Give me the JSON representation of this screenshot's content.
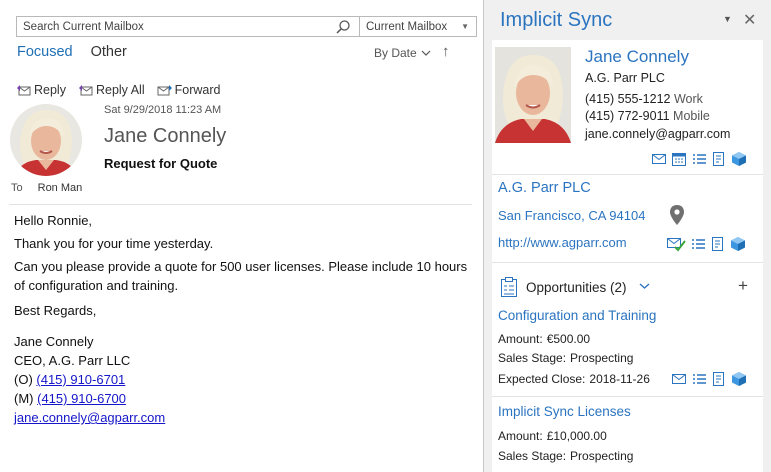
{
  "mail": {
    "search_placeholder": "Search Current Mailbox",
    "scope": "Current Mailbox",
    "tabs": {
      "focused": "Focused",
      "other": "Other"
    },
    "sort_label": "By Date",
    "actions": {
      "reply": "Reply",
      "reply_all": "Reply All",
      "forward": "Forward"
    },
    "date": "Sat 9/29/2018 11:23 AM",
    "sender": "Jane Connely",
    "subject": "Request for Quote",
    "to_label": "To",
    "to_name": "Ron Man",
    "body": {
      "greeting": "Hello Ronnie,",
      "line1": "Thank you for your time yesterday.",
      "line2": "Can you please provide a quote for 500 user licenses. Please include 10 hours of configuration and training.",
      "closing": "Best Regards,",
      "sig_name": "Jane Connely",
      "sig_title": "CEO, A.G. Parr LLC",
      "sig_office_prefix": "(O) ",
      "sig_office": "(415) 910-6701",
      "sig_mobile_prefix": "(M) ",
      "sig_mobile": "(415) 910-6700",
      "sig_email": "jane.connely@agparr.com"
    }
  },
  "panel": {
    "title": "Implicit Sync",
    "contact": {
      "name": "Jane Connely",
      "company": "A.G. Parr PLC",
      "phone_work": "(415) 555-1212",
      "phone_work_label": "Work",
      "phone_mobile": "(415) 772-9011",
      "phone_mobile_label": "Mobile",
      "email": "jane.connely@agparr.com"
    },
    "account": {
      "name": "A.G. Parr PLC",
      "city": "San Francisco, CA 94104",
      "website": "http://www.agparr.com"
    },
    "opportunities": {
      "header": "Opportunities (2)",
      "items": [
        {
          "title": "Configuration and Training",
          "amount_label": "Amount:",
          "amount": "€500.00",
          "stage_label": "Sales Stage:",
          "stage": "Prospecting",
          "close_label": "Expected Close:",
          "close": "2018-11-26"
        },
        {
          "title": "Implicit Sync Licenses",
          "amount_label": "Amount:",
          "amount": "£10,000.00",
          "stage_label": "Sales Stage:",
          "stage": "Prospecting"
        }
      ]
    }
  },
  "colors": {
    "accent": "#2b74c0",
    "link": "#1515c9"
  }
}
